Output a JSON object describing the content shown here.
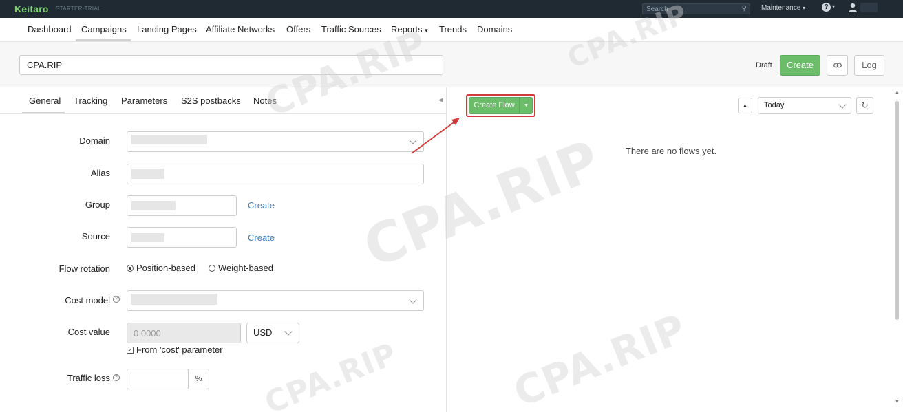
{
  "topbar": {
    "brand": "Keitaro",
    "plan": "STARTER-TRIAL",
    "search_placeholder": "Search",
    "maintenance": "Maintenance",
    "caret": "▾",
    "help_glyph": "?"
  },
  "nav": {
    "items": [
      "Dashboard",
      "Campaigns",
      "Landing Pages",
      "Affiliate Networks",
      "Offers",
      "Traffic Sources",
      "Reports",
      "Trends",
      "Domains"
    ],
    "reports_caret": "▾",
    "active": "Campaigns"
  },
  "campaign": {
    "name": "CPA.RIP",
    "status": "Draft",
    "create_label": "Create",
    "log_label": "Log"
  },
  "tabs": [
    "General",
    "Tracking",
    "Parameters",
    "S2S postbacks",
    "Notes"
  ],
  "form": {
    "domain_label": "Domain",
    "alias_label": "Alias",
    "group_label": "Group",
    "source_label": "Source",
    "create_link": "Create",
    "flow_rotation_label": "Flow rotation",
    "rotation_options": [
      "Position-based",
      "Weight-based"
    ],
    "rotation_selected": "Position-based",
    "cost_model_label": "Cost model",
    "cost_value_label": "Cost value",
    "cost_value_placeholder": "0.0000",
    "currency": "USD",
    "from_cost_param": "From 'cost' parameter",
    "traffic_loss_label": "Traffic loss",
    "percent": "%"
  },
  "flows": {
    "create_flow_label": "Create Flow",
    "period": "Today",
    "empty_message": "There are no flows yet."
  },
  "watermark": "CPA.RIP",
  "colors": {
    "topbar_bg": "#1f2a33",
    "brand_green": "#7ed06d",
    "button_green": "#6cbd6a",
    "highlight_red": "#d33a3a",
    "link_blue": "#3a7fc2"
  }
}
